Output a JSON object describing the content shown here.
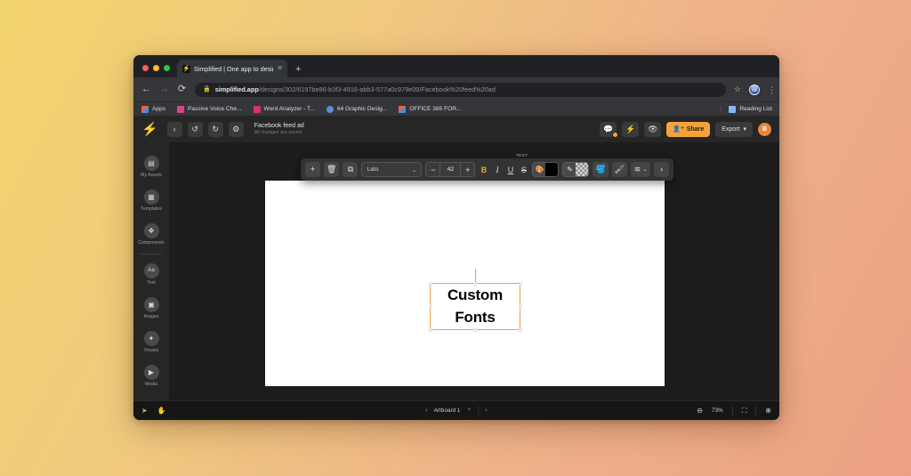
{
  "browser": {
    "tab": {
      "title": "Simplified | One app to design,",
      "favicon_icon": "simplified-logo-icon",
      "close_icon": "close-icon"
    },
    "new_tab_label": "+",
    "nav": {
      "back_icon": "back-arrow-icon",
      "forward_icon": "forward-arrow-icon",
      "reload_icon": "reload-icon"
    },
    "omnibox": {
      "lock_icon": "lock-icon",
      "url_domain": "simplified.app",
      "url_path": "/designs/302/6197be86-b3f3-4916-abb3-577a0c979e09/Facebook%20feed%20ad",
      "star_icon": "bookmark-star-icon",
      "menu_icon": "kebab-menu-icon"
    },
    "bookmarks": [
      {
        "label": "Apps",
        "color": "#e8643c"
      },
      {
        "label": "Passive Voice Che...",
        "color": "#e0408a"
      },
      {
        "label": "Word Analyzer - T...",
        "color": "#d6327a"
      },
      {
        "label": "64 Graphic Desig...",
        "color": "#5b8fd6"
      },
      {
        "label": "OFFICE 365 FOR...",
        "color": "#e8643c"
      }
    ],
    "reading_list_label": "Reading List"
  },
  "app": {
    "header": {
      "logo_icon": "simplified-bolt-logo-icon",
      "back_icon": "chevron-left-icon",
      "undo_icon": "undo-icon",
      "redo_icon": "redo-icon",
      "settings_icon": "gear-icon",
      "doc_title": "Facebook feed ad",
      "doc_status": "All changes are saved.",
      "comment_icon": "comment-icon",
      "upgrade_icon": "lightning-bolt-icon",
      "preview_icon": "eye-icon",
      "share_label": "Share",
      "share_icon": "person-add-icon",
      "share_color": "#f2a33c",
      "export_label": "Export",
      "export_caret": "▾",
      "avatar_initial": "B",
      "avatar_color": "#e8873b"
    },
    "sidebar": {
      "items": [
        {
          "label": "My Assets",
          "icon": "folder-icon",
          "glyph": "▤"
        },
        {
          "label": "Templates",
          "icon": "templates-grid-icon",
          "glyph": "▦"
        },
        {
          "label": "Components",
          "icon": "components-icon",
          "glyph": "❖"
        },
        {
          "label": "Text",
          "icon": "text-aa-icon",
          "glyph": "Aa"
        },
        {
          "label": "Images",
          "icon": "image-icon",
          "glyph": "▣"
        },
        {
          "label": "Visuals",
          "icon": "visuals-icon",
          "glyph": "✦"
        },
        {
          "label": "Media",
          "icon": "play-media-icon",
          "glyph": "▶"
        }
      ],
      "divider_after_index": 2
    },
    "toolbar": {
      "section_label": "TEXT",
      "add_icon": "plus-icon",
      "delete_icon": "trash-icon",
      "duplicate_icon": "copy-icon",
      "font_family": "Lato",
      "font_caret": "⌄",
      "size_decrease": "−",
      "font_size": "42",
      "size_increase": "+",
      "bold_label": "B",
      "bold_active": true,
      "italic_label": "I",
      "underline_label": "U",
      "strike_label": "S",
      "palette_icon": "color-palette-icon",
      "fill_color": "#000000",
      "eyedropper_icon": "eyedropper-icon",
      "transparent_icon": "transparent-checker-icon",
      "bucket_icon": "paint-bucket-icon",
      "brush_icon": "brush-icon",
      "layers_icon": "layers-icon",
      "layers_caret": "⌄",
      "more_icon": "chevron-right-icon",
      "accent_color": "#f2a33c"
    },
    "canvas": {
      "text_object": {
        "lines": [
          "Custom",
          "Fonts"
        ],
        "selection_color": "#f2a33c",
        "text_color": "#000000"
      },
      "artboard_background": "#ffffff"
    },
    "bottom_bar": {
      "select_tool_icon": "cursor-arrow-icon",
      "hand_tool_icon": "hand-icon",
      "prev_artboard_icon": "chevron-left-icon",
      "artboard_label": "Artboard 1",
      "artboard_caret_icon": "chevron-up-icon",
      "next_artboard_icon": "chevron-right-icon",
      "zoom_out_icon": "zoom-out-icon",
      "zoom_level": "73%",
      "fit_screen_icon": "fit-to-screen-icon",
      "zoom_in_icon": "zoom-in-icon"
    }
  }
}
